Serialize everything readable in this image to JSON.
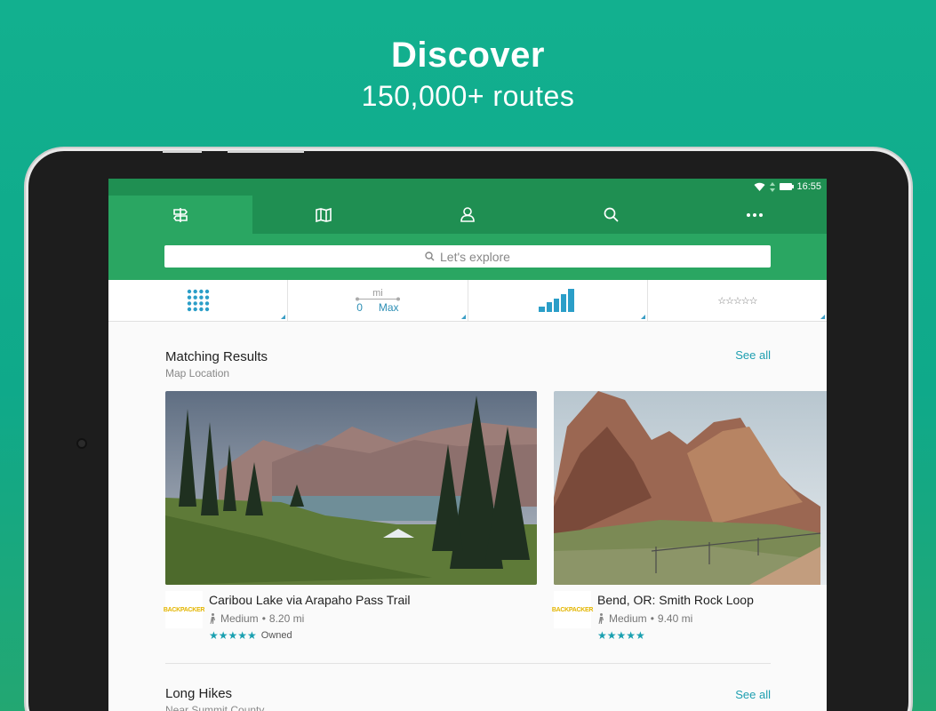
{
  "promo": {
    "title": "Discover",
    "subtitle": "150,000+ routes"
  },
  "status": {
    "time": "16:55"
  },
  "tabs": [
    {
      "icon": "signpost-icon",
      "active": true
    },
    {
      "icon": "map-icon",
      "active": false
    },
    {
      "icon": "profile-icon",
      "active": false
    },
    {
      "icon": "search-icon",
      "active": false
    },
    {
      "icon": "more-icon",
      "active": false
    }
  ],
  "search": {
    "placeholder": "Let's explore"
  },
  "filters": {
    "distance": {
      "unit": "mi",
      "min": "0",
      "max": "Max"
    },
    "stars": "☆☆☆☆☆"
  },
  "sections": [
    {
      "title": "Matching Results",
      "subtitle": "Map Location",
      "see_all": "See all",
      "cards": [
        {
          "name": "Caribou Lake via Arapaho Pass Trail",
          "logo": "BACKPACKER",
          "difficulty": "Medium",
          "distance": "8.20 mi",
          "stars": "★★★★★",
          "badge": "Owned"
        },
        {
          "name": "Bend, OR: Smith Rock Loop",
          "logo": "BACKPACKER",
          "difficulty": "Medium",
          "distance": "9.40 mi",
          "stars": "★★★★★",
          "badge": ""
        }
      ]
    },
    {
      "title": "Long Hikes",
      "subtitle": "Near Summit County",
      "see_all": "See all"
    }
  ],
  "colors": {
    "accent": "#2aa662",
    "dark_green": "#1f8f52",
    "teal": "#1e9fb0"
  }
}
